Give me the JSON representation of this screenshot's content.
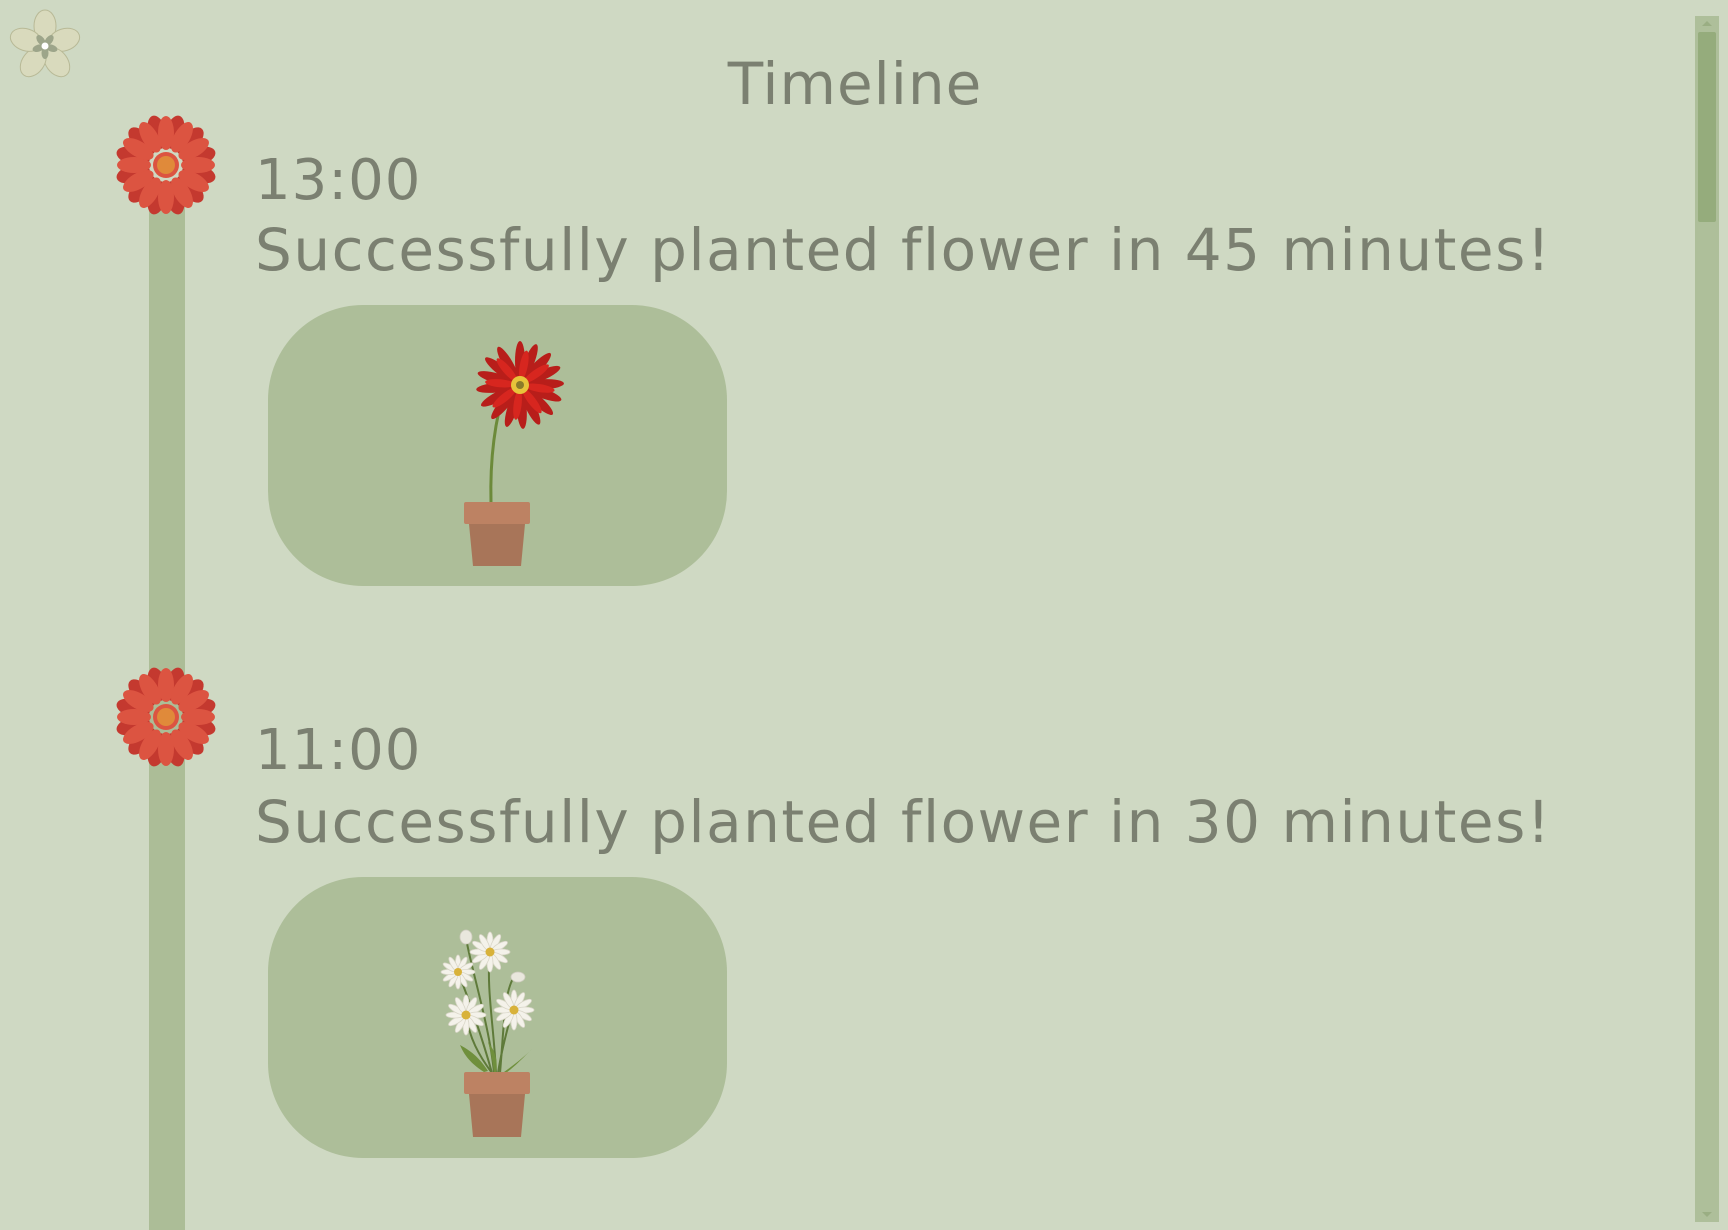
{
  "page": {
    "title": "Timeline"
  },
  "colors": {
    "background": "#cfd9c3",
    "timeline_line": "#acbd97",
    "card": "#adbe99",
    "text": "#7b8071",
    "node_flower_petals": "#dc5441",
    "node_flower_center": "#e08a3a",
    "pot": "#a87559"
  },
  "menu": {
    "icon": "daisy-menu-icon"
  },
  "entries": [
    {
      "time": "13:00",
      "message": "Successfully planted flower in 45 minutes!",
      "flower": "red-gerbera-in-pot"
    },
    {
      "time": "11:00",
      "message": "Successfully planted flower in 30 minutes!",
      "flower": "white-daisies-in-pot"
    }
  ]
}
